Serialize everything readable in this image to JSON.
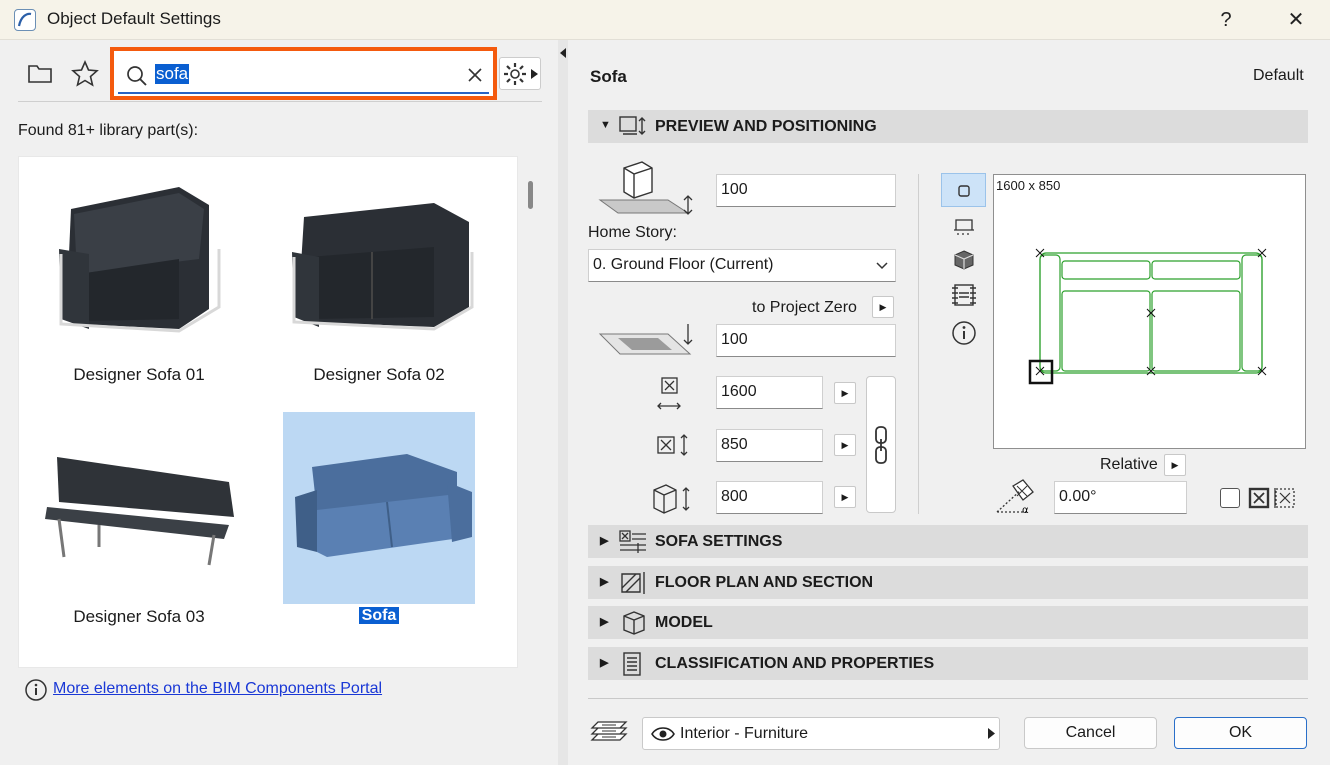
{
  "window": {
    "title": "Object Default Settings",
    "help": "?",
    "close": "✕"
  },
  "search": {
    "value": "sofa"
  },
  "found_text": "Found 81+ library part(s):",
  "library": [
    {
      "label": "Designer Sofa 01"
    },
    {
      "label": "Designer Sofa 02"
    },
    {
      "label": "Designer Sofa 03"
    },
    {
      "label": "Sofa",
      "selected": true
    }
  ],
  "portal_link": "More elements on the BIM Components Portal",
  "header": {
    "name": "Sofa",
    "default": "Default"
  },
  "sections": {
    "preview": "PREVIEW AND POSITIONING",
    "sofa_settings": "SOFA SETTINGS",
    "floor_plan": "FLOOR PLAN AND SECTION",
    "model": "MODEL",
    "classification": "CLASSIFICATION AND PROPERTIES"
  },
  "positioning": {
    "elevation": "100",
    "home_story_label": "Home Story:",
    "home_story_value": "0. Ground Floor (Current)",
    "to_project_zero": "to Project Zero",
    "project_zero_value": "100",
    "width": "1600",
    "depth": "850",
    "height": "800",
    "preview_dims": "1600 x 850",
    "relative": "Relative",
    "angle": "0.00°"
  },
  "footer": {
    "layer": "Interior - Furniture",
    "cancel": "Cancel",
    "ok": "OK"
  },
  "colors": {
    "accent": "#0a5fd1",
    "highlight": "#f45a0e",
    "preview_line": "#2ca02c"
  }
}
